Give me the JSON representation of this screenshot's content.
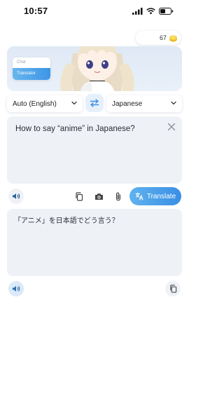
{
  "status": {
    "time": "10:57"
  },
  "coins": {
    "count": "67"
  },
  "mode": {
    "chat": "Chat",
    "translator": "Translator"
  },
  "languages": {
    "source": "Auto (English)",
    "target": "Japanese"
  },
  "input": {
    "text": "How to say “anime” in Japanese?"
  },
  "translate": {
    "label": "Translate"
  },
  "output": {
    "text": "「アニメ」を日本語でどう言う？"
  },
  "colors": {
    "accent": "#3a8fe4",
    "card": "#eef2f7",
    "hero": "#dfe9f5"
  }
}
